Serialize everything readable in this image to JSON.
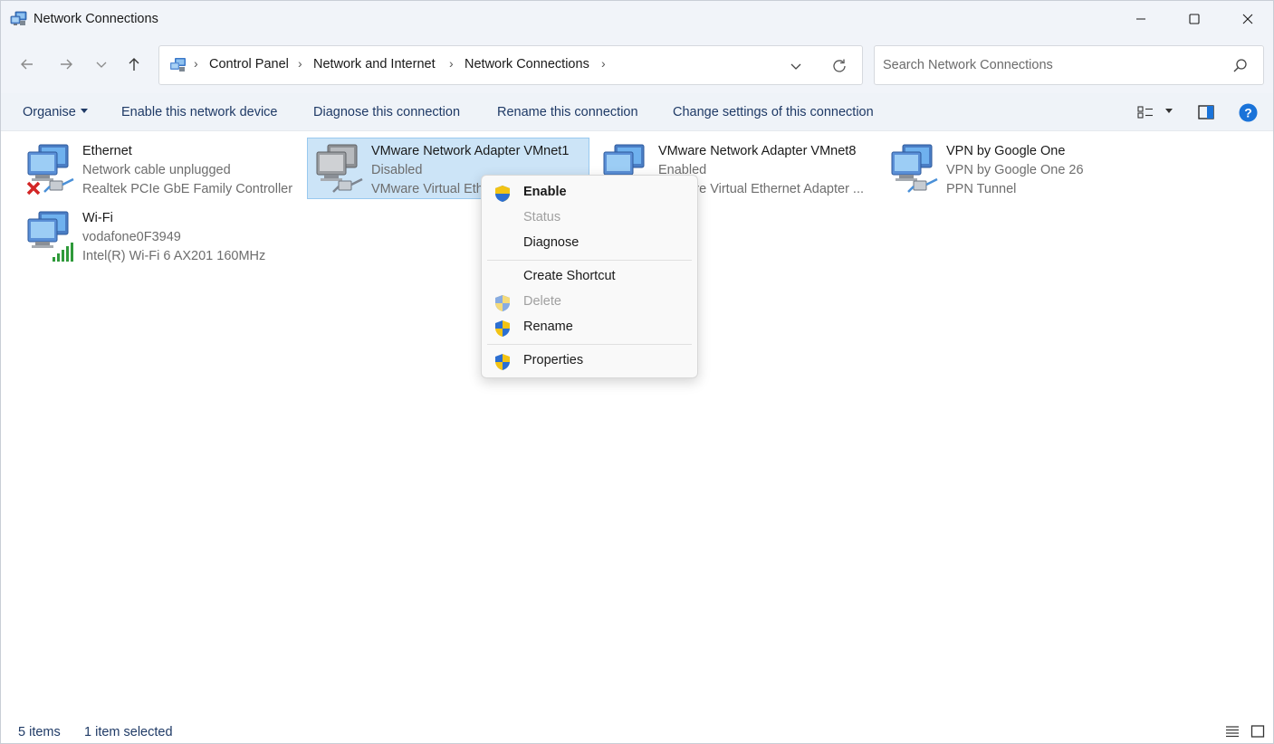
{
  "window": {
    "title": "Network Connections",
    "icon": "network-connections-icon"
  },
  "address": {
    "crumbs": [
      "Control Panel",
      "Network and Internet",
      "Network Connections"
    ],
    "separator": "›",
    "search_placeholder": "Search Network Connections"
  },
  "toolbar": {
    "organise": "Organise",
    "enable": "Enable this network device",
    "diagnose": "Diagnose this connection",
    "rename": "Rename this connection",
    "change": "Change settings of this connection"
  },
  "connections": [
    {
      "name": "Ethernet",
      "status": "Network cable unplugged",
      "device": "Realtek PCIe GbE Family Controller",
      "state_icon": "red-x-icon",
      "selected": false
    },
    {
      "name": "VMware Network Adapter VMnet1",
      "status": "Disabled",
      "device": "VMware Virtual Ethernet Adapter ...",
      "state_icon": "cable-icon",
      "selected": true
    },
    {
      "name": "VMware Network Adapter VMnet8",
      "status": "Enabled",
      "device": "VMware Virtual Ethernet Adapter ...",
      "state_icon": "cable-icon",
      "selected": false
    },
    {
      "name": "VPN by Google One",
      "status": "VPN by Google One 26",
      "device": "PPN Tunnel",
      "state_icon": "cable-icon",
      "selected": false
    },
    {
      "name": "Wi-Fi",
      "status": "vodafone0F3949",
      "device": "Intel(R) Wi-Fi 6 AX201 160MHz",
      "state_icon": "wifi-signal-icon",
      "selected": false
    }
  ],
  "context_menu": {
    "items": [
      {
        "label": "Enable",
        "shield": true,
        "bold": true,
        "disabled": false
      },
      {
        "label": "Status",
        "shield": false,
        "bold": false,
        "disabled": true
      },
      {
        "label": "Diagnose",
        "shield": false,
        "bold": false,
        "disabled": false
      },
      {
        "label": "Create Shortcut",
        "shield": false,
        "bold": false,
        "disabled": false
      },
      {
        "label": "Delete",
        "shield": true,
        "bold": false,
        "disabled": true
      },
      {
        "label": "Rename",
        "shield": true,
        "bold": false,
        "disabled": false
      },
      {
        "label": "Properties",
        "shield": true,
        "bold": false,
        "disabled": false
      }
    ]
  },
  "status_bar": {
    "items_count": "5 items",
    "selected_count": "1 item selected"
  },
  "colors": {
    "accent": "#0067c0",
    "selection": "#cce4f7",
    "chrome": "#f1f4f9"
  }
}
